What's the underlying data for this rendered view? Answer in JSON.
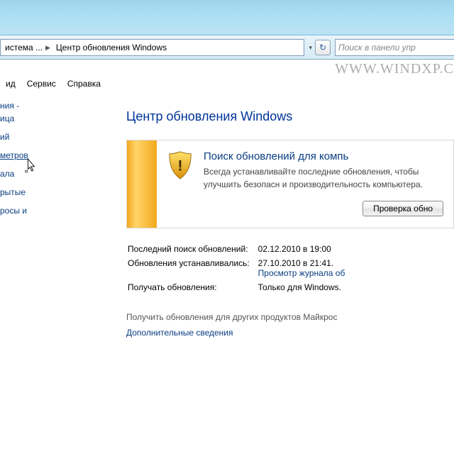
{
  "breadcrumb": {
    "crumb1": "истема ...",
    "crumb2": "Центр обновления Windows"
  },
  "search": {
    "placeholder": "Поиск в панели упр"
  },
  "watermark": "WWW.WINDXP.C",
  "menu": {
    "item1": "ид",
    "item2": "Сервис",
    "item3": "Справка"
  },
  "sidebar": {
    "l1": "ния -\nица",
    "l2": "ий",
    "l3": "метров",
    "l4": "ала",
    "l5": "рытые",
    "l6": "росы и"
  },
  "main": {
    "heading": "Центр обновления Windows",
    "notice": {
      "title": "Поиск обновлений для компь",
      "body": "Всегда устанавливайте последние обновления, чтобы улучшить безопасн и производительность компьютера.",
      "button": "Проверка обно"
    },
    "info": {
      "r1_label": "Последний поиск обновлений:",
      "r1_value": "02.12.2010 в 19:00",
      "r2_label": "Обновления устанавливались:",
      "r2_value": "27.10.2010 в 21:41.",
      "r2_link": "Просмотр журнала об",
      "r3_label": "Получать обновления:",
      "r3_value": "Только для Windows."
    },
    "bottom": {
      "line1": "Получить обновления для других продуктов Майкрос",
      "link": "Дополнительные сведения"
    }
  }
}
